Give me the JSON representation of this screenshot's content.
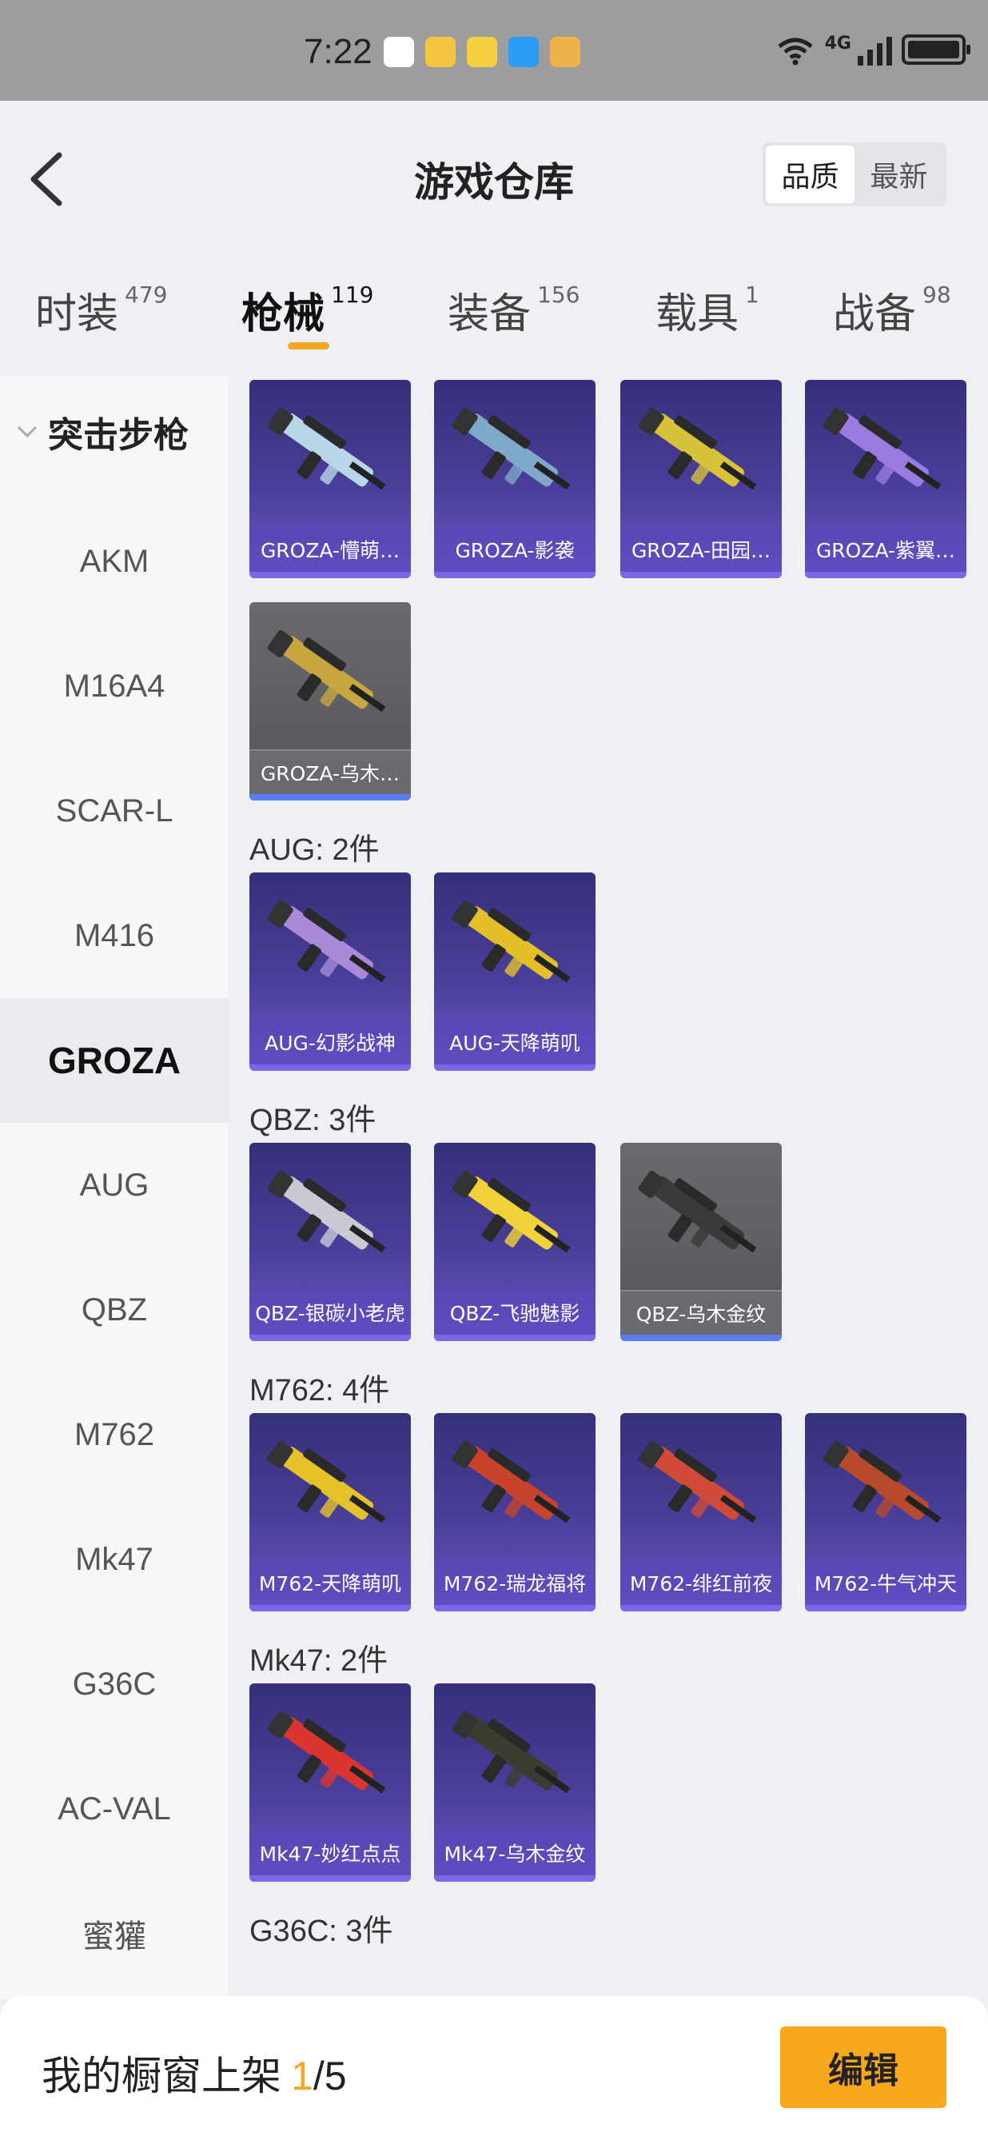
{
  "status_bar": {
    "time": "7:22",
    "network": "4G"
  },
  "header": {
    "title": "游戏仓库",
    "sort_options": [
      "品质",
      "最新"
    ],
    "sort_active": "品质"
  },
  "tabs": [
    {
      "label": "时装",
      "count": "479"
    },
    {
      "label": "枪械",
      "count": "119",
      "active": true
    },
    {
      "label": "装备",
      "count": "156"
    },
    {
      "label": "载具",
      "count": "1"
    },
    {
      "label": "战备",
      "count": "98"
    }
  ],
  "sidebar": {
    "group": "突击步枪",
    "items": [
      "AKM",
      "M16A4",
      "SCAR-L",
      "M416",
      "GROZA",
      "AUG",
      "QBZ",
      "M762",
      "Mk47",
      "G36C",
      "AC-VAL",
      "蜜獾"
    ],
    "active": "GROZA"
  },
  "sections": [
    {
      "label": "",
      "items": [
        {
          "name": "GROZA-懵萌…",
          "rarity": "purple"
        },
        {
          "name": "GROZA-影袭",
          "rarity": "purple"
        },
        {
          "name": "GROZA-田园…",
          "rarity": "purple"
        },
        {
          "name": "GROZA-紫翼…",
          "rarity": "purple"
        },
        {
          "name": "GROZA-乌木…",
          "rarity": "gray"
        }
      ]
    },
    {
      "label": "AUG: 2件",
      "items": [
        {
          "name": "AUG-幻影战神",
          "rarity": "purple"
        },
        {
          "name": "AUG-天降萌叽",
          "rarity": "purple"
        }
      ]
    },
    {
      "label": "QBZ: 3件",
      "items": [
        {
          "name": "QBZ-银碳小老虎",
          "rarity": "purple"
        },
        {
          "name": "QBZ-飞驰魅影",
          "rarity": "purple"
        },
        {
          "name": "QBZ-乌木金纹",
          "rarity": "gray"
        }
      ]
    },
    {
      "label": "M762: 4件",
      "items": [
        {
          "name": "M762-天降萌叽",
          "rarity": "purple"
        },
        {
          "name": "M762-瑞龙福将",
          "rarity": "purple"
        },
        {
          "name": "M762-绯红前夜",
          "rarity": "purple"
        },
        {
          "name": "M762-牛气冲天",
          "rarity": "purple"
        }
      ]
    },
    {
      "label": "Mk47: 2件",
      "items": [
        {
          "name": "Mk47-妙红点点",
          "rarity": "purple"
        },
        {
          "name": "Mk47-乌木金纹",
          "rarity": "purple"
        }
      ]
    },
    {
      "label": "G36C: 3件",
      "items": []
    }
  ],
  "bottom_bar": {
    "text": "我的橱窗上架",
    "count": "1",
    "total": "/5",
    "edit_label": "编辑"
  },
  "colors": {
    "accent": "#f5a623",
    "purple_card": "#4a3f9a",
    "gray_card": "#5a5a60"
  }
}
